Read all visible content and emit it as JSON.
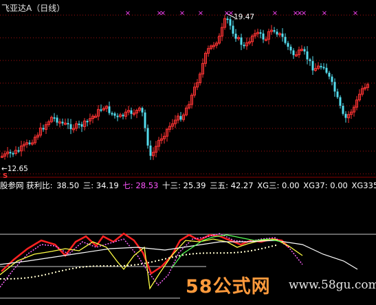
{
  "header": {
    "title": "飞亚达A（日线）"
  },
  "price_panel": {
    "high_label": "19.47",
    "low_label": "←12.65",
    "s_marker": "S",
    "colors": {
      "up": "#ff3333",
      "down": "#55ddee",
      "grid": "#aa1111",
      "marker": "#ff44ff"
    }
  },
  "indicator_row": {
    "name": "股参网 获利比:",
    "items": [
      {
        "label": "",
        "value": "38.50",
        "color": "#ffffff"
      },
      {
        "label": "三:",
        "value": "34.19",
        "color": "#ffffff"
      },
      {
        "label": "七:",
        "value": "28.53",
        "color": "#ff55ff"
      },
      {
        "label": "十三:",
        "value": "25.39",
        "color": "#ffffff"
      },
      {
        "label": "三五:",
        "value": "42.27",
        "color": "#ffffff"
      },
      {
        "label": "XG三:",
        "value": "0.00",
        "color": "#ffffff"
      },
      {
        "label": "XG37:",
        "value": "0.00",
        "color": "#ffffff"
      },
      {
        "label": "XG335:",
        "value": "",
        "color": "#ffffff"
      }
    ]
  },
  "watermark": {
    "logo": "58公式网",
    "url": "www.58gu.com"
  }
}
